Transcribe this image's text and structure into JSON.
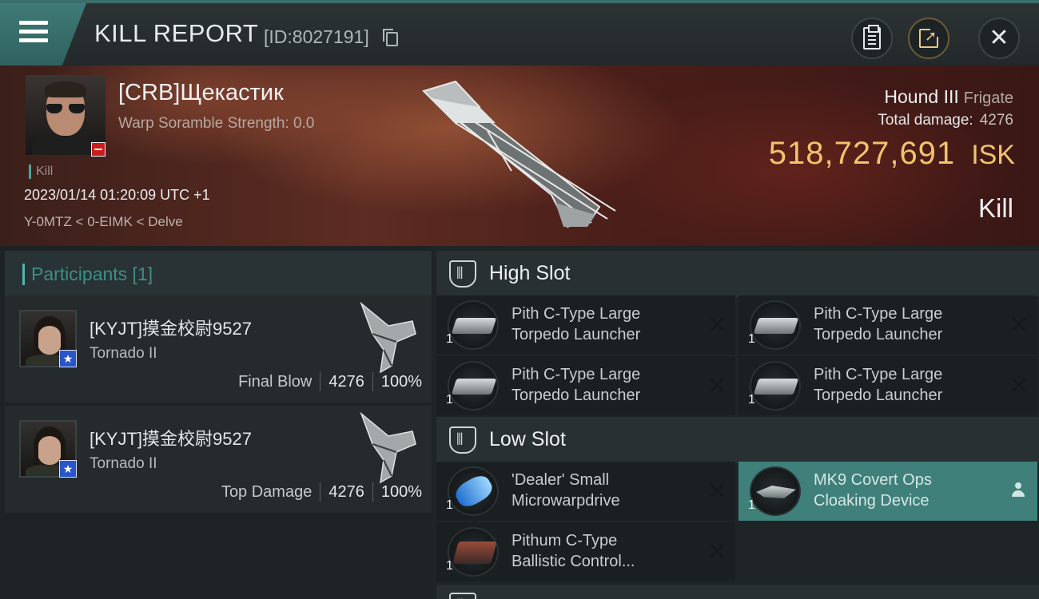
{
  "header": {
    "title": "KILL REPORT",
    "report_id": "[ID:8027191]",
    "menu_icon": "hamburger-menu-icon",
    "buttons": [
      "clipboard-icon",
      "share-icon",
      "close-icon"
    ]
  },
  "victim": {
    "name": "[CRB]Щекастик",
    "scramble": "Warp Soramble Strength: 0.0",
    "kill_tag": "Kill",
    "time": "2023/01/14 01:20:09 UTC +1",
    "location": "Y-0MTZ < 0-EIMK < Delve",
    "ship": "Hound III",
    "ship_class": "Frigate",
    "total_damage_label": "Total damage:",
    "total_damage": "4276",
    "isk_value": "518,727,691",
    "isk_unit": "ISK",
    "status": "Kill"
  },
  "participants": {
    "heading": "Participants [1]",
    "items": [
      {
        "name": "[KYJT]摸金校尉9527",
        "ship": "Tornado II",
        "label": "Final Blow",
        "damage": "4276",
        "percent": "100%"
      },
      {
        "name": "[KYJT]摸金校尉9527",
        "ship": "Tornado II",
        "label": "Top Damage",
        "damage": "4276",
        "percent": "100%"
      }
    ]
  },
  "fitting": {
    "high_slot": {
      "label": "High Slot",
      "modules": [
        {
          "line1": "Pith C-Type Large",
          "line2": "Torpedo Launcher",
          "qty": "1"
        },
        {
          "line1": "Pith C-Type Large",
          "line2": "Torpedo Launcher",
          "qty": "1"
        },
        {
          "line1": "Pith C-Type Large",
          "line2": "Torpedo Launcher",
          "qty": "1"
        },
        {
          "line1": "Pith C-Type Large",
          "line2": "Torpedo Launcher",
          "qty": "1"
        }
      ]
    },
    "low_slot": {
      "label": "Low Slot",
      "modules": [
        {
          "line1": "'Dealer' Small",
          "line2": "Microwarpdrive",
          "qty": "1"
        },
        {
          "line1": "MK9 Covert Ops",
          "line2": "Cloaking Device",
          "qty": "1"
        },
        {
          "line1": "Pithum C-Type",
          "line2": "Ballistic Control...",
          "qty": "1"
        }
      ]
    }
  },
  "colors": {
    "accent_teal": "#3f807b",
    "isk_gold": "#f2c36b",
    "neg_badge": "#c81d1d"
  }
}
